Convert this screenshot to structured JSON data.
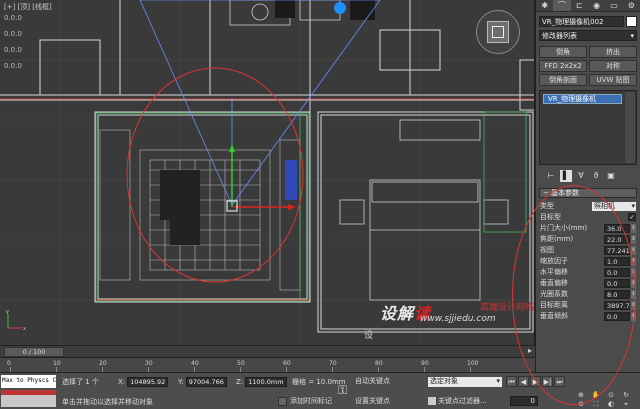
{
  "viewport": {
    "label": "[+] [顶] [线框]",
    "coords": [
      "0.0.0",
      "0.0.0",
      "0.0.0",
      "0.0.0"
    ]
  },
  "watermark": {
    "logo_main": "设解",
    "logo_accent": "读",
    "url": "www.sjjiedu.com",
    "cn_text": "高端设计网络学",
    "prefix": "设"
  },
  "panel": {
    "tabs": [
      "✱",
      "⌒",
      "⊏",
      "◉",
      "▭",
      "⚙"
    ],
    "object_name": "VR_物理摄像机002",
    "modifier_list": "修改器列表",
    "buttons": [
      "倒角",
      "挤出",
      "FFD 2x2x2",
      "对称",
      "倒角剖面",
      "UVW 贴图"
    ],
    "stack_item": "VR_物理摄像机",
    "tools": [
      "⊢",
      "▌",
      "∀",
      "ϑ",
      "▣"
    ],
    "rollout_title": "基本参数",
    "params": [
      {
        "label": "类型",
        "kind": "select",
        "value": "照相机"
      },
      {
        "label": "目标型",
        "kind": "check",
        "value": "✓"
      },
      {
        "label": "片门大小(mm)",
        "kind": "num",
        "value": "36.0"
      },
      {
        "label": "焦距(mm)",
        "kind": "num",
        "value": "22.0"
      },
      {
        "label": "视图",
        "kind": "num",
        "value": "77.241"
      },
      {
        "label": "缩放因子",
        "kind": "num",
        "value": "1.0"
      },
      {
        "label": "水平偏移",
        "kind": "num",
        "value": "0.0"
      },
      {
        "label": "垂直偏移",
        "kind": "num",
        "value": "0.0"
      },
      {
        "label": "光圈系数",
        "kind": "num",
        "value": "8.0"
      },
      {
        "label": "目标距离",
        "kind": "num",
        "value": "3897.7"
      },
      {
        "label": "垂直倾斜",
        "kind": "num",
        "value": "0.0"
      }
    ]
  },
  "timeline": {
    "slider": "0 / 100",
    "arrow": "▸",
    "ticks": [
      "0",
      "10",
      "20",
      "30",
      "40",
      "50",
      "60",
      "70",
      "80",
      "90",
      "100"
    ]
  },
  "status": {
    "maxscript": "Max to Physcs C",
    "selected": "选择了 1 个",
    "hint": "单击并拖动以选择并移动对象",
    "x_label": "X:",
    "x_value": "104895.92",
    "y_label": "Y:",
    "y_value": "97004.766",
    "z_label": "Z:",
    "z_value": "1100.0mm",
    "grid": "栅格 = 10.0mm",
    "add_time_tag": "添加时间标记",
    "auto_key": "自动关键点",
    "set_key": "设置关键点",
    "selection_set": "选定对象",
    "key_filter": "关键点过滤器...",
    "frame": "0",
    "play": [
      "⏮",
      "◀",
      "▶",
      "▶|",
      "⏭"
    ],
    "nav": [
      "⊕",
      "✋",
      "⊙",
      "↻",
      "⊕",
      "⛶",
      "◐",
      "⌖"
    ]
  }
}
